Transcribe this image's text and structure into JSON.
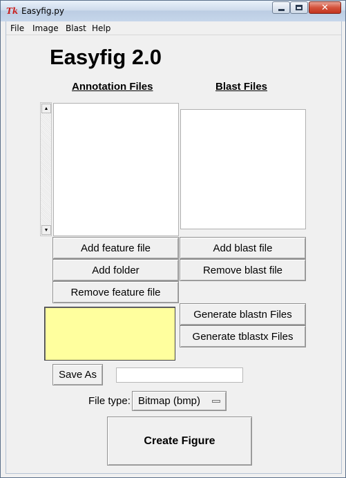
{
  "window": {
    "title": "Easyfig.py",
    "app_icon": "Tk",
    "app_icon_name": "tk-feather-icon",
    "close_glyph": "✕"
  },
  "menu": {
    "items": [
      "File",
      "Image",
      "Blast",
      "Help"
    ]
  },
  "app": {
    "title": "Easyfig 2.0"
  },
  "annotation": {
    "heading": "Annotation Files",
    "buttons": {
      "add_feature": "Add feature file",
      "add_folder": "Add folder",
      "remove_feature": "Remove feature file"
    }
  },
  "blast": {
    "heading": "Blast Files",
    "buttons": {
      "add_blast": "Add blast file",
      "remove_blast": "Remove blast file",
      "generate_blastn": "Generate blastn Files",
      "generate_tblastx": "Generate tblastx Files"
    }
  },
  "scrollbar": {
    "up_arrow": "▲",
    "down_arrow": "▼"
  },
  "save": {
    "button": "Save As",
    "filename_value": ""
  },
  "file_type": {
    "label": "File type:",
    "selected": "Bitmap (bmp)"
  },
  "actions": {
    "create_figure": "Create Figure"
  },
  "colors": {
    "status_box": "#ffff9e",
    "window_bg": "#f0f0f0",
    "close_button": "#c2341f"
  }
}
